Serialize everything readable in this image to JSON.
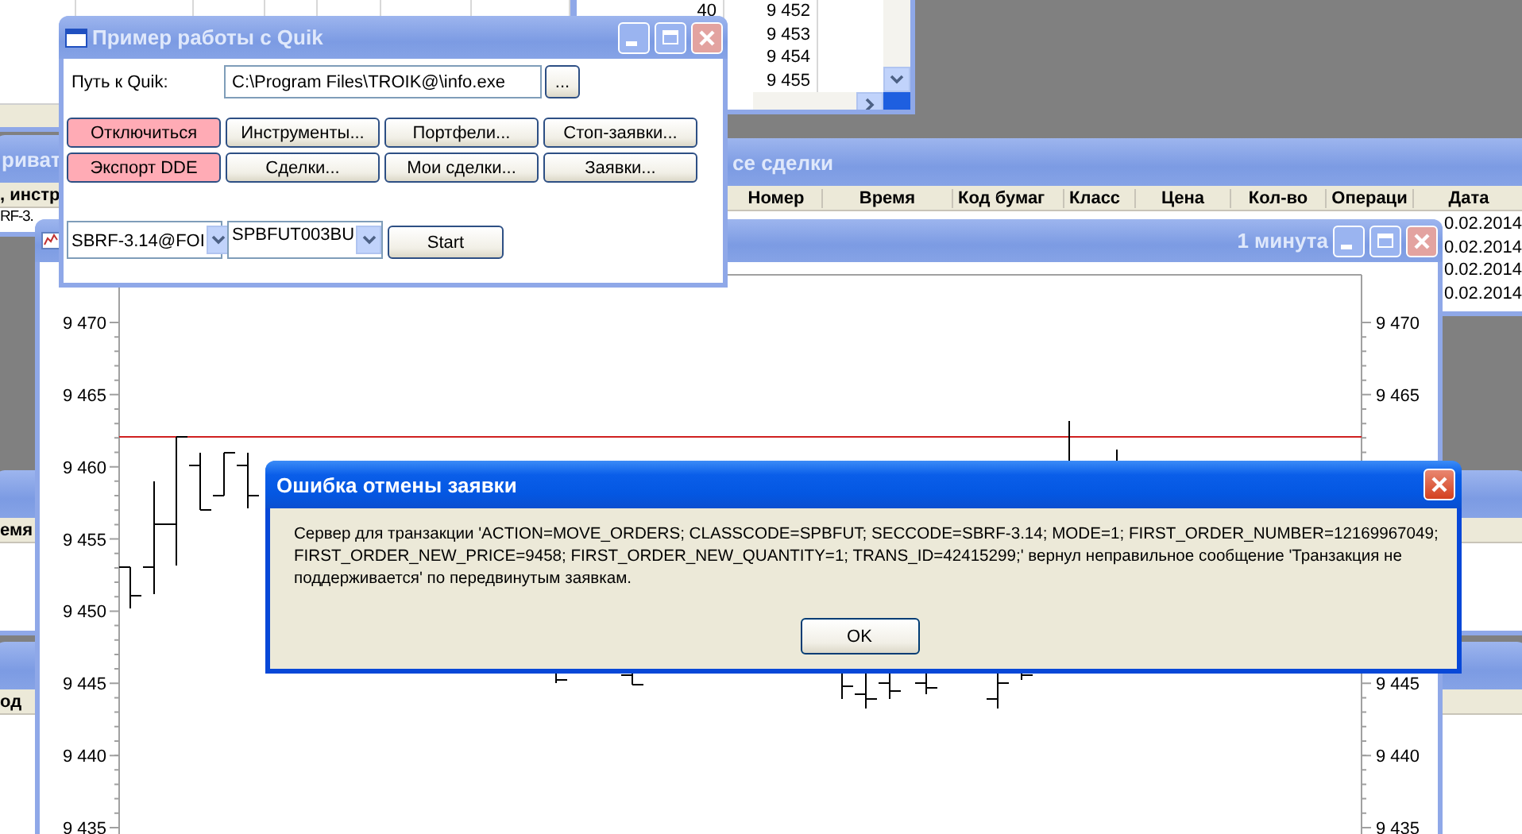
{
  "top_list_window": {
    "rows": [
      {
        "column_1": "40",
        "column_2": "9 452"
      },
      {
        "column_2": "9 453"
      },
      {
        "column_2": "9 454"
      },
      {
        "column_2": "9 455"
      }
    ]
  },
  "left_window": {
    "title": "риват",
    "column_header": ", инстр",
    "cell": "RF-3."
  },
  "trades_window": {
    "title": "се сделки",
    "columns": [
      "Номер",
      "Время",
      "Код бумаг",
      "Класс",
      "Цена",
      "Кол-во",
      "Операци",
      "Дата"
    ],
    "dates": [
      "0.02.2014",
      "0.02.2014",
      "0.02.2014",
      "0.02.2014"
    ]
  },
  "lower_window_1": {
    "column_header": "емя"
  },
  "lower_window_2": {
    "column_header": "од"
  },
  "chart_window": {
    "title": "1 минута",
    "y_axis_left": [
      "9 470",
      "9 465",
      "9 460",
      "9 455",
      "9 450",
      "9 445",
      "9 440",
      "9 435"
    ],
    "y_axis_right_upper": [
      "9 470",
      "9 465"
    ],
    "y_axis_right_lower": [
      "9 445",
      "9 440",
      "9 435"
    ]
  },
  "quik_window": {
    "title": "Пример работы с Quik",
    "path_label": "Путь к Quik:",
    "path_value": "C:\\Program Files\\TROIK@\\info.exe",
    "browse_button": "...",
    "buttons": [
      {
        "label": "Отключиться",
        "highlighted": true
      },
      {
        "label": "Инструменты...",
        "highlighted": false
      },
      {
        "label": "Портфели...",
        "highlighted": false
      },
      {
        "label": "Стоп-заявки...",
        "highlighted": false
      },
      {
        "label": "Экспорт DDE",
        "highlighted": true
      },
      {
        "label": "Сделки...",
        "highlighted": false
      },
      {
        "label": "Мои сделки...",
        "highlighted": false
      },
      {
        "label": "Заявки...",
        "highlighted": false
      }
    ],
    "instrument_combo": "SBRF-3.14@FOI",
    "class_combo": "SPBFUT003BU",
    "start_button": "Start"
  },
  "dialog": {
    "title": "Ошибка отмены заявки",
    "message": "Сервер для транзакции 'ACTION=MOVE_ORDERS; CLASSCODE=SPBFUT; SECCODE=SBRF-3.14; MODE=1; FIRST_ORDER_NUMBER=12169967049; FIRST_ORDER_NEW_PRICE=9458; FIRST_ORDER_NEW_QUANTITY=1; TRANS_ID=42415299;' вернул неправильное сообщение 'Транзакция не поддерживается' по передвинутым заявкам.",
    "button": "OK"
  }
}
